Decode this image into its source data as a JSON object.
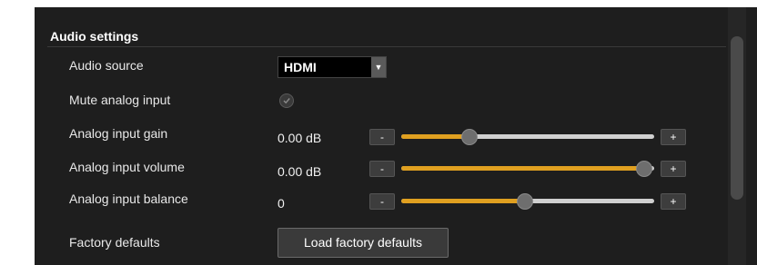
{
  "section": {
    "title": "Audio settings"
  },
  "audio_source": {
    "label": "Audio source",
    "value": "HDMI"
  },
  "mute": {
    "label": "Mute analog input",
    "checked": false
  },
  "gain": {
    "label": "Analog input gain",
    "value": "0.00 dB",
    "level": 0.27,
    "minus": "-",
    "plus": "+"
  },
  "volume": {
    "label": "Analog input volume",
    "value": "0.00 dB",
    "level": 0.96,
    "minus": "-",
    "plus": "+"
  },
  "balance": {
    "label": "Analog input balance",
    "value": "0",
    "level": 0.49,
    "minus": "-",
    "plus": "+"
  },
  "factory": {
    "label": "Factory defaults",
    "button": "Load factory defaults"
  },
  "colors": {
    "accent": "#e0a020",
    "panel": "#1e1e1e"
  }
}
